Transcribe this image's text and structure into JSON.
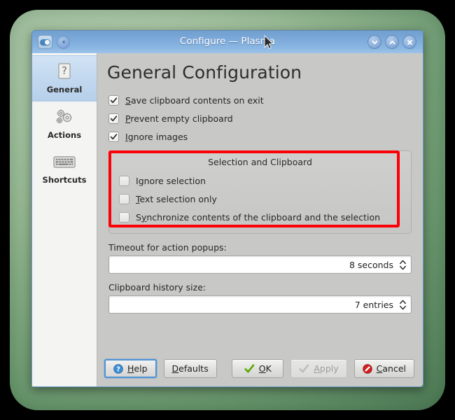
{
  "window": {
    "title": "Configure — Plasma",
    "titlebar_buttons": [
      {
        "name": "shade-button",
        "icon": "chevron-down-icon"
      },
      {
        "name": "maximize-button",
        "icon": "chevron-up-icon"
      },
      {
        "name": "close-button",
        "icon": "close-icon"
      }
    ],
    "menu_icon": "window-menu-icon",
    "help_circle_icon": "titlebar-circle-icon"
  },
  "sidebar": {
    "items": [
      {
        "label": "General",
        "icon": "question-mark-icon",
        "selected": true
      },
      {
        "label": "Actions",
        "icon": "gears-icon",
        "selected": false
      },
      {
        "label": "Shortcuts",
        "icon": "keyboard-icon",
        "selected": false
      }
    ]
  },
  "main": {
    "page_title": "General Configuration",
    "checkboxes": [
      {
        "label_pre": "",
        "accel": "S",
        "label_post": "ave clipboard contents on exit",
        "checked": true
      },
      {
        "label_pre": "",
        "accel": "P",
        "label_post": "revent empty clipboard",
        "checked": true
      },
      {
        "label_pre": "",
        "accel": "I",
        "label_post": "gnore images",
        "checked": true
      }
    ],
    "group": {
      "title": "Selection and Clipboard",
      "highlight_color": "#fb0007",
      "checkboxes": [
        {
          "label_pre": "I",
          "accel": "g",
          "label_post": "nore selection",
          "checked": false
        },
        {
          "label_pre": "",
          "accel": "T",
          "label_post": "ext selection only",
          "checked": false
        },
        {
          "label_pre": "S",
          "accel": "y",
          "label_post": "nchronize contents of the clipboard and the selection",
          "checked": false
        }
      ]
    },
    "fields": [
      {
        "label": "Timeout for action popups:",
        "value": "8 seconds"
      },
      {
        "label": "Clipboard history size:",
        "value": "7 entries"
      }
    ]
  },
  "buttons": {
    "help": {
      "pre": "",
      "accel": "H",
      "post": "elp",
      "icon": "help-icon",
      "focused": true,
      "disabled": false
    },
    "defaults": {
      "pre": "",
      "accel": "D",
      "post": "efaults",
      "icon": "",
      "focused": false,
      "disabled": false
    },
    "ok": {
      "pre": "",
      "accel": "O",
      "post": "K",
      "icon": "check-icon",
      "focused": false,
      "disabled": false
    },
    "apply": {
      "pre": "",
      "accel": "A",
      "post": "pply",
      "icon": "check-icon",
      "focused": false,
      "disabled": true
    },
    "cancel": {
      "pre": "",
      "accel": "C",
      "post": "ancel",
      "icon": "cancel-icon",
      "focused": false,
      "disabled": false
    }
  },
  "colors": {
    "titlebar": "#7daada",
    "desktop_frame": "#8fb48b",
    "selection": "#c2d8ef",
    "highlight": "#fb0007"
  }
}
